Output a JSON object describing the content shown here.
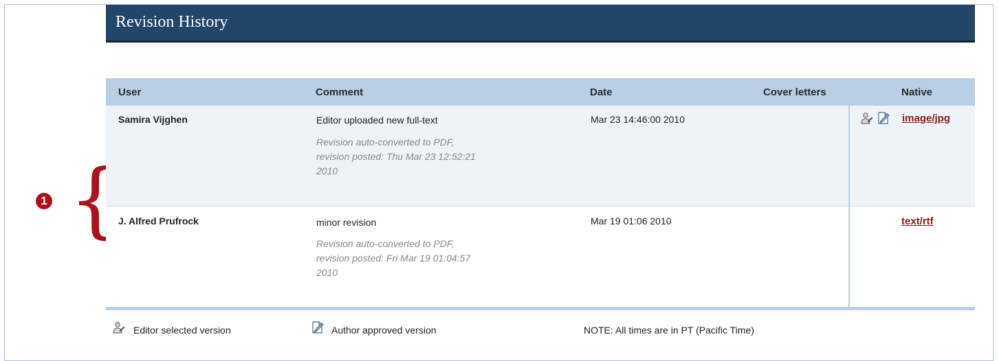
{
  "header": {
    "title": "Revision History"
  },
  "columns": {
    "user": "User",
    "comment": "Comment",
    "date": "Date",
    "cover_letters": "Cover letters",
    "native": "Native"
  },
  "rows": [
    {
      "user": "Samira Vijghen",
      "comment": "Editor uploaded new full-text",
      "note_lines": [
        "Revision auto-converted to PDF,",
        "revision posted: Thu Mar 23 12:52:21",
        "2010"
      ],
      "date": "Mar 23 14:46:00 2010",
      "native_link": "image/jpg",
      "icons": [
        "editor-selected-icon",
        "author-approved-icon"
      ]
    },
    {
      "user": "J. Alfred Prufrock",
      "comment": "minor revision",
      "note_lines": [
        "Revision auto-converted to PDF,",
        "revision posted: Fri Mar 19 01:04:57",
        "2010"
      ],
      "date": "Mar 19 01:06 2010",
      "native_link": "text/rtf",
      "icons": []
    }
  ],
  "legend": {
    "editor_selected": "Editor selected version",
    "author_approved": "Author approved version",
    "note": "NOTE: All times are in PT (Pacific Time)"
  },
  "annotation": {
    "marker": "1"
  },
  "colors": {
    "header_bg": "#23456a",
    "table_header_bg": "#b8cfe5",
    "link": "#8b1a1a",
    "annotation": "#b0101a"
  }
}
